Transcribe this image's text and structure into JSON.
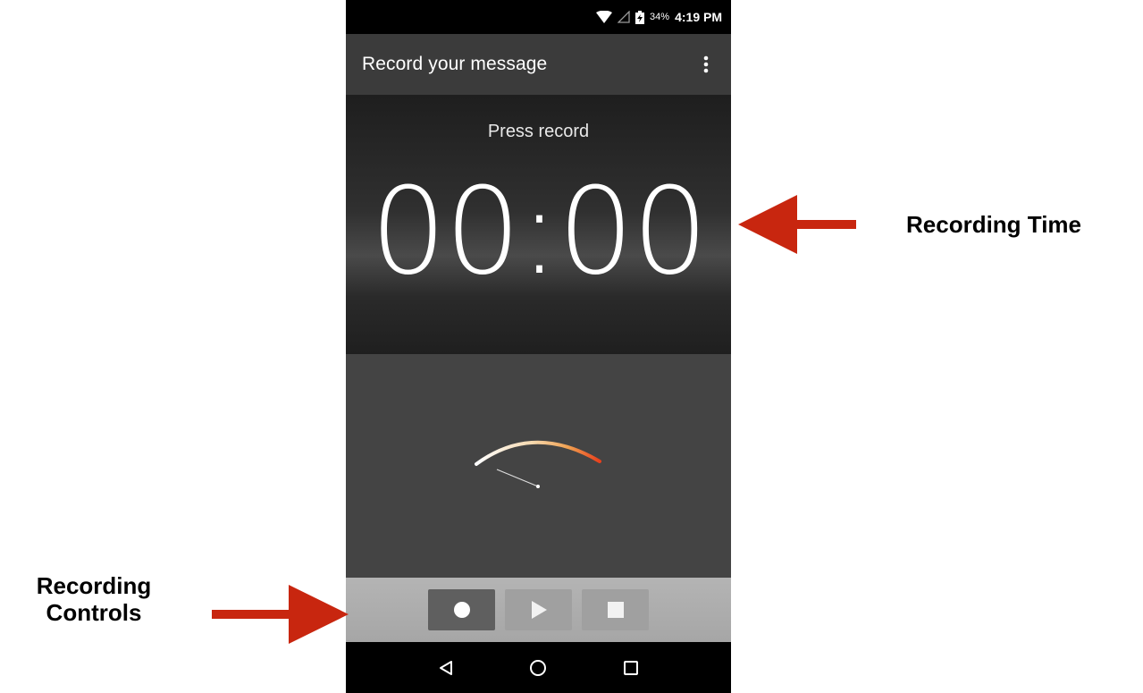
{
  "status_bar": {
    "battery_percent": "34%",
    "time": "4:19 PM",
    "icons": [
      "wifi-icon",
      "signal-icon",
      "battery-charging-icon"
    ]
  },
  "app_bar": {
    "title": "Record your message",
    "menu_icon": "more-vert-icon"
  },
  "recorder": {
    "status_text": "Press record",
    "elapsed_time": "00:00",
    "meter_level": 0
  },
  "controls": [
    {
      "name": "record",
      "icon": "record-icon",
      "state": "enabled"
    },
    {
      "name": "play",
      "icon": "play-icon",
      "state": "disabled"
    },
    {
      "name": "stop",
      "icon": "stop-icon",
      "state": "disabled"
    }
  ],
  "nav_bar": [
    "back-icon",
    "home-icon",
    "recents-icon"
  ],
  "annotations": {
    "recording_time": "Recording Time",
    "recording_controls_line1": "Recording",
    "recording_controls_line2": "Controls"
  },
  "colors": {
    "arrow": "#c8260f",
    "meter_gradient_start": "#ffffff",
    "meter_gradient_end": "#e8401c"
  }
}
